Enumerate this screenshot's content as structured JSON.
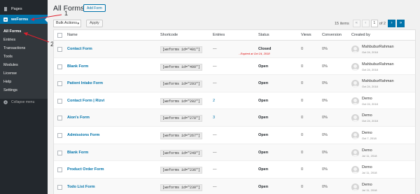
{
  "sidebar": {
    "pages_label": "Pages",
    "weforms_label": "weForms",
    "submenu": [
      "All Forms",
      "Entries",
      "Transactions",
      "Tools",
      "Modules",
      "License",
      "Help",
      "Settings"
    ],
    "collapse_label": "Collapse menu"
  },
  "annotations": {
    "one": "1",
    "two": "2",
    "color": "#e0202e"
  },
  "header": {
    "title": "All Forms",
    "add_button": "Add Form"
  },
  "toolbar": {
    "bulk_actions": "Bulk Actions",
    "apply": "Apply"
  },
  "pagination": {
    "count": "15 items",
    "first": "«",
    "prev": "‹",
    "current": "1",
    "of": "of 2",
    "next": "›",
    "last": "»"
  },
  "columns": {
    "name": "Name",
    "shortcode": "Shortcode",
    "entries": "Entries",
    "status": "Status",
    "views": "Views",
    "conversion": "Conversion",
    "created_by": "Created by"
  },
  "rows": [
    {
      "name": "Contact Form",
      "shortcode": "[weforms id=\"401\"]",
      "entries": "—",
      "status": "Closed",
      "expired": "- Expired at Oct 24, 2018",
      "views": "0",
      "conversion": "0%",
      "created_by": "MahbuburRahman",
      "date": "Oct 24, 2018"
    },
    {
      "name": "Blank Form",
      "shortcode": "[weforms id=\"400\"]",
      "entries": "—",
      "status": "Open",
      "expired": "",
      "views": "0",
      "conversion": "0%",
      "created_by": "MahbuburRahman",
      "date": "Oct 24, 2018"
    },
    {
      "name": "Patient Intake Form",
      "shortcode": "[weforms id=\"293\"]",
      "entries": "—",
      "status": "Open",
      "expired": "",
      "views": "0",
      "conversion": "0%",
      "created_by": "MahbuburRahman",
      "date": "Oct 24, 2018"
    },
    {
      "name": "Contact Form | Rizvi",
      "shortcode": "[weforms id=\"282\"]",
      "entries": "2",
      "status": "Open",
      "expired": "",
      "views": "0",
      "conversion": "0%",
      "created_by": "Demo",
      "date": "Oct 24, 2018"
    },
    {
      "name": "Aion's Form",
      "shortcode": "[weforms id=\"278\"]",
      "entries": "3",
      "status": "Open",
      "expired": "",
      "views": "0",
      "conversion": "0%",
      "created_by": "Demo",
      "date": "Oct 24, 2018"
    },
    {
      "name": "Admissions Form",
      "shortcode": "[weforms id=\"267\"]",
      "entries": "—",
      "status": "Open",
      "expired": "",
      "views": "0",
      "conversion": "0%",
      "created_by": "Demo",
      "date": "Oct 7, 2018"
    },
    {
      "name": "Blank Form",
      "shortcode": "[weforms id=\"249\"]",
      "entries": "—",
      "status": "Open",
      "expired": "",
      "views": "0",
      "conversion": "0%",
      "created_by": "Demo",
      "date": "Jul 11, 2018"
    },
    {
      "name": "Product Order Form",
      "shortcode": "[weforms id=\"236\"]",
      "entries": "—",
      "status": "Open",
      "expired": "",
      "views": "0",
      "conversion": "0%",
      "created_by": "Demo",
      "date": "Jul 11, 2018"
    },
    {
      "name": "Todo List Form",
      "shortcode": "[weforms id=\"230\"]",
      "entries": "—",
      "status": "Open",
      "expired": "",
      "views": "0",
      "conversion": "0%",
      "created_by": "Demo",
      "date": "Jul 11, 2018"
    }
  ]
}
